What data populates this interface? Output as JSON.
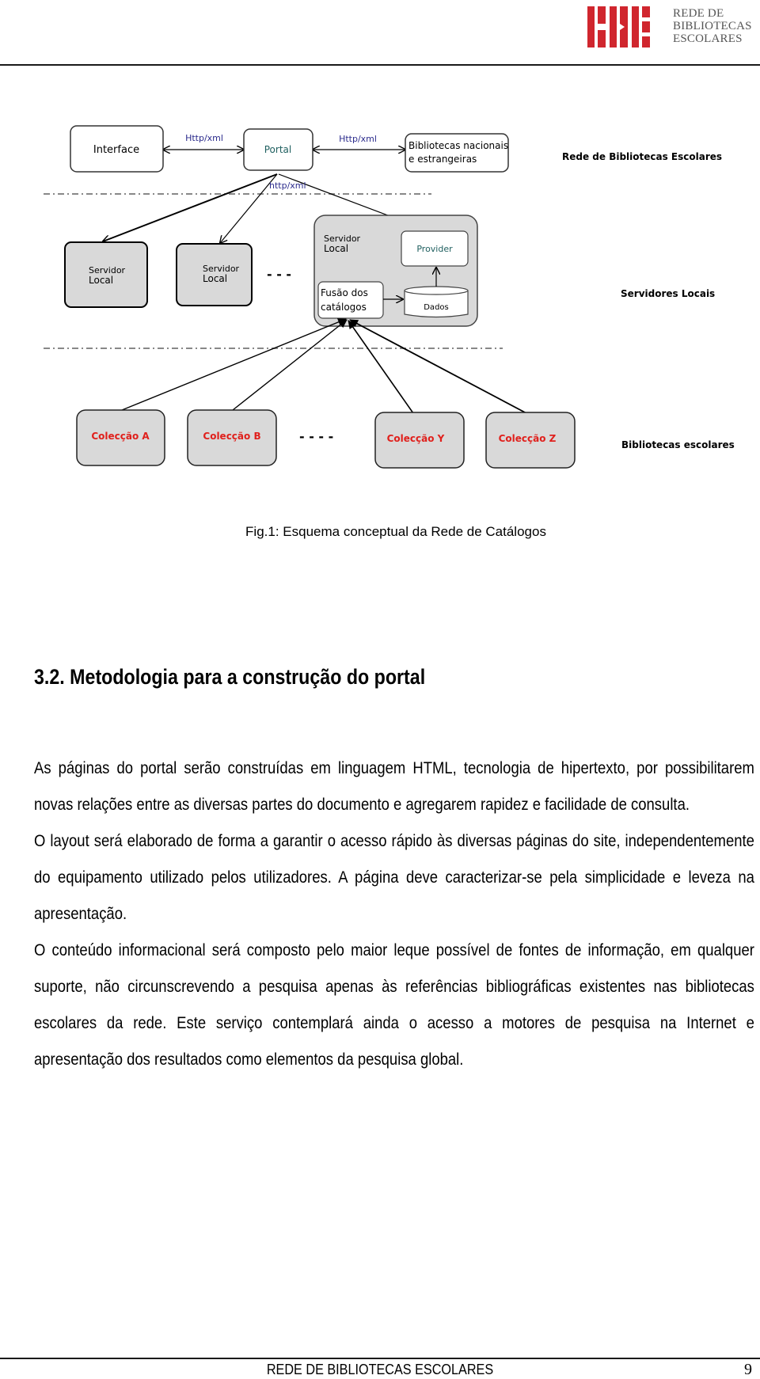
{
  "header": {
    "logo": {
      "mark": "RBE",
      "lines": [
        "REDE DE",
        "BIBLIOTECAS",
        "ESCOLARES"
      ],
      "brand_color": "#d0262e"
    }
  },
  "diagram": {
    "nodes": {
      "interface": "Interface",
      "portal": "Portal",
      "bibliotecas": [
        "Bibliotecas nacionais",
        "e estrangeiras"
      ],
      "servidor_local_1": [
        "Servidor",
        "Local"
      ],
      "servidor_local_2": [
        "Servidor",
        "Local"
      ],
      "servidor_local_main": [
        "Servidor",
        "Local"
      ],
      "provider": "Provider",
      "fusao": [
        "Fusão dos",
        "catálogos"
      ],
      "dados": "Dados",
      "coleccao_a": "Colecção A",
      "coleccao_b": "Colecção B",
      "coleccao_y": "Colecção Y",
      "coleccao_z": "Colecção Z"
    },
    "edge_labels": {
      "interface_portal": "Http/xml",
      "portal_bibliotecas": "Http/xml",
      "portal_servers": "http/xml"
    },
    "ellipsis_servers": "- - -",
    "ellipsis_collections": "- - - -",
    "tiers": {
      "top": "Rede de Bibliotecas Escolares",
      "middle": "Servidores Locais",
      "bottom": "Bibliotecas escolares"
    },
    "colors": {
      "box_fill": "#d9d9d9",
      "collection_text": "#e0201c",
      "link_text": "#2b2b8c",
      "portal_text": "#1f5f5f"
    }
  },
  "caption": "Fig.1: Esquema conceptual da Rede de Catálogos",
  "section": {
    "title": "3.2. Metodologia para a construção do portal",
    "paragraphs": [
      "As páginas do portal serão construídas em linguagem HTML, tecnologia de hipertexto, por possibilitarem novas relações entre as diversas partes do documento e agregarem rapidez e facilidade de consulta.",
      "O layout será elaborado de forma a garantir o acesso rápido às diversas páginas do site, independentemente do equipamento utilizado pelos utilizadores. A página deve caracterizar-se pela simplicidade e leveza na apresentação.",
      "O conteúdo informacional será composto pelo maior leque possível de fontes de informação, em qualquer suporte, não circunscrevendo a pesquisa apenas às referências bibliográficas existentes nas bibliotecas escolares da rede. Este serviço contemplará ainda o acesso a motores de pesquisa na Internet e apresentação dos resultados como elementos da pesquisa global."
    ]
  },
  "footer": {
    "text": "REDE DE BIBLIOTECAS ESCOLARES",
    "page_number": "9"
  }
}
